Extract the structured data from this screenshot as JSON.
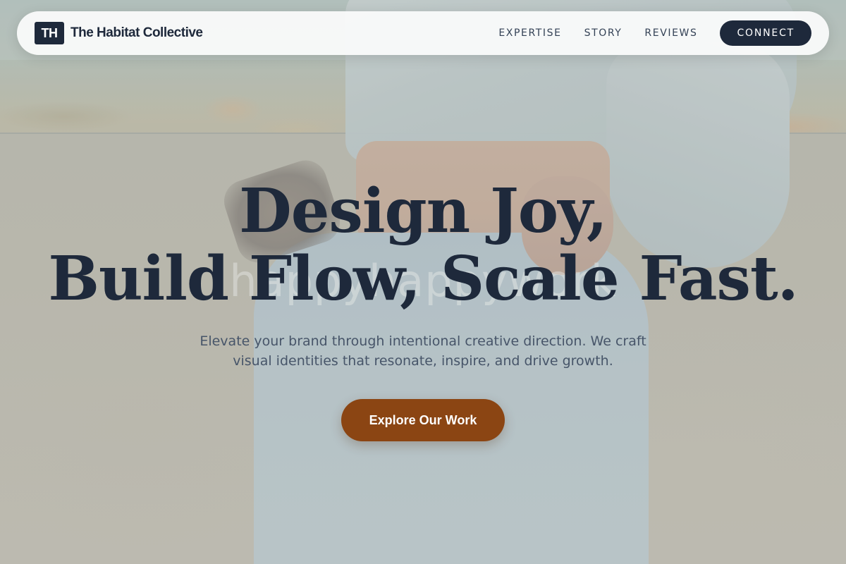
{
  "brand": {
    "mark": "TH",
    "name": "The Habitat Collective"
  },
  "nav": {
    "links": [
      "EXPERTISE",
      "STORY",
      "REVIEWS"
    ],
    "cta_label": "CONNECT"
  },
  "hero": {
    "headline_line1": "Design Joy,",
    "headline_line2": "Build Flow, Scale Fast.",
    "subtitle": "Elevate your brand through intentional creative direction. We craft visual identities that resonate, inspire, and drive growth.",
    "cta_label": "Explore Our Work",
    "background_watermark": "happyhappywork"
  },
  "colors": {
    "primary": "#1e293b",
    "accent": "#8b4513",
    "muted_text": "#475569"
  }
}
